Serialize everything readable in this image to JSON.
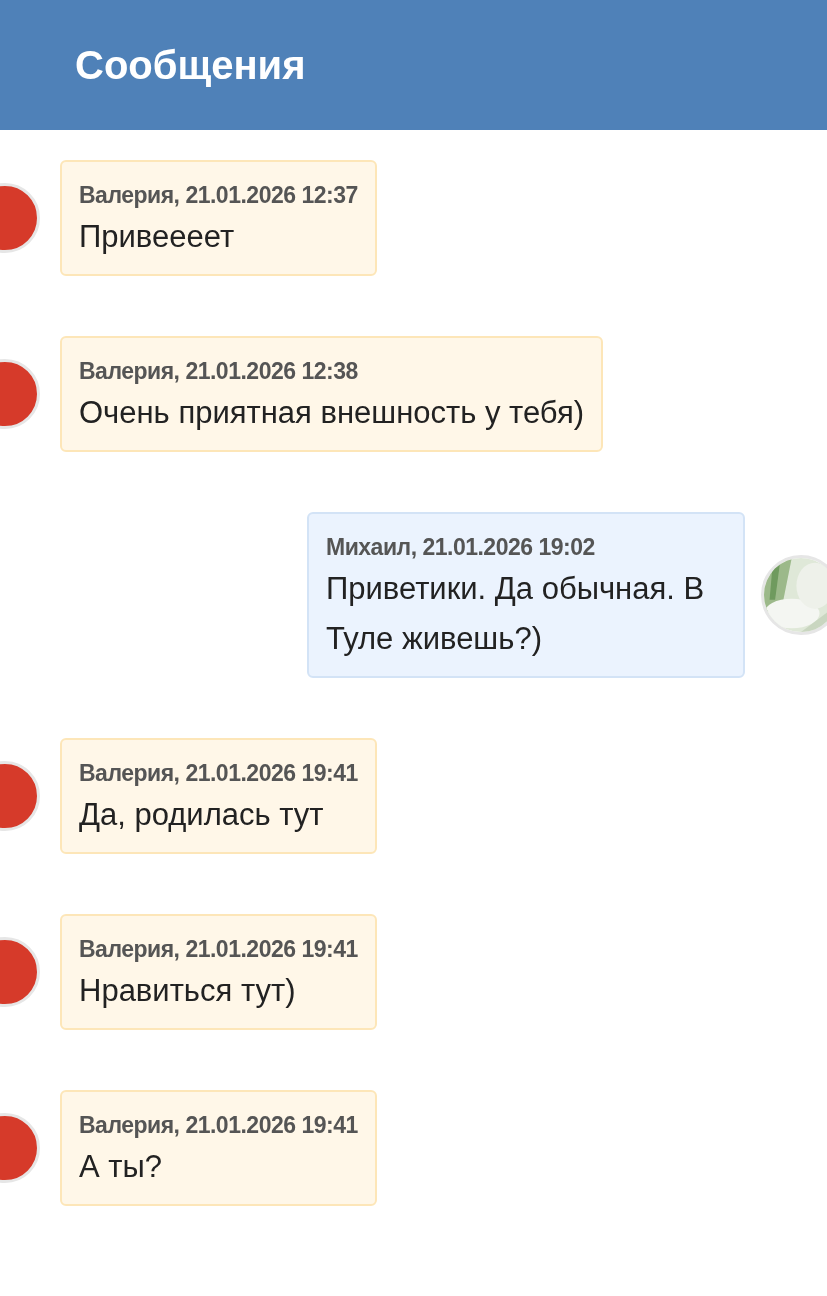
{
  "header": {
    "title": "Сообщения"
  },
  "messages": [
    {
      "kind": "incoming",
      "meta": "Валерия, 21.01.2026 12:37",
      "text": "Привеееет"
    },
    {
      "kind": "incoming",
      "meta": "Валерия, 21.01.2026 12:38",
      "text": "Очень приятная внешность у тебя)"
    },
    {
      "kind": "outgoing",
      "meta": "Михаил, 21.01.2026 19:02",
      "text": "Приветики. Да обычная. В Туле живешь?)"
    },
    {
      "kind": "incoming",
      "meta": "Валерия, 21.01.2026 19:41",
      "text": "Да, родилась тут"
    },
    {
      "kind": "incoming",
      "meta": "Валерия, 21.01.2026 19:41",
      "text": "Нравиться тут)"
    },
    {
      "kind": "incoming",
      "meta": "Валерия, 21.01.2026 19:41",
      "text": "А ты?"
    }
  ]
}
